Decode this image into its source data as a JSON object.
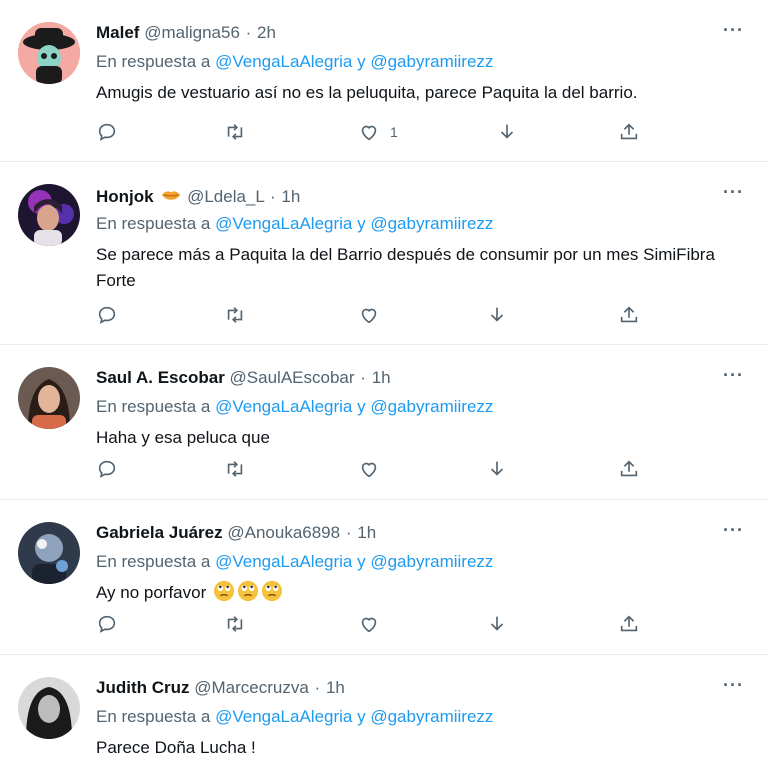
{
  "colors": {
    "link": "#1d9bf0",
    "muted": "#536471",
    "text": "#0f1419",
    "divider": "#eceef0"
  },
  "replies": [
    {
      "name": "Malef",
      "name_suffix": "",
      "handle": "@maligna56",
      "time": "2h",
      "replying_prefix": "En respuesta a ",
      "mention1": "@VengaLaAlegria",
      "conj": " y ",
      "mention2": "@gabyramiirezz",
      "text": "Amugis de vestuario así no es la peluquita, parece Paquita la del barrio.",
      "like_count": "1",
      "more": "···"
    },
    {
      "name": "Honjok",
      "name_suffix": "",
      "handle": "@Ldela_L",
      "time": "1h",
      "replying_prefix": "En respuesta a ",
      "mention1": "@VengaLaAlegria",
      "conj": " y ",
      "mention2": "@gabyramiirezz",
      "text": "Se parece más a Paquita la del Barrio después de consumir por un mes SimiFibra Forte",
      "like_count": "",
      "more": "···"
    },
    {
      "name": "Saul A. Escobar",
      "name_suffix": "",
      "handle": "@SaulAEscobar",
      "time": "1h",
      "replying_prefix": "En respuesta a ",
      "mention1": "@VengaLaAlegria",
      "conj": " y ",
      "mention2": "@gabyramiirezz",
      "text": "Haha y esa peluca que",
      "like_count": "",
      "more": "···"
    },
    {
      "name": "Gabriela Juárez",
      "name_suffix": "",
      "handle": "@Anouka6898",
      "time": "1h",
      "replying_prefix": "En respuesta a ",
      "mention1": "@VengaLaAlegria",
      "conj": " y ",
      "mention2": "@gabyramiirezz",
      "text": "Ay no porfavor",
      "like_count": "",
      "more": "···"
    },
    {
      "name": "Judith Cruz",
      "name_suffix": "",
      "handle": "@Marcecruzva",
      "time": "1h",
      "replying_prefix": "En respuesta a ",
      "mention1": "@VengaLaAlegria",
      "conj": " y ",
      "mention2": "@gabyramiirezz",
      "text": "Parece Doña Lucha !",
      "like_count": "",
      "more": "···"
    }
  ],
  "separator": "·",
  "icons": [
    "reply-icon",
    "retweet-icon",
    "like-icon",
    "download-icon",
    "share-icon",
    "more-icon",
    "lips-emoji-icon",
    "eye-roll-emoji-icon"
  ]
}
